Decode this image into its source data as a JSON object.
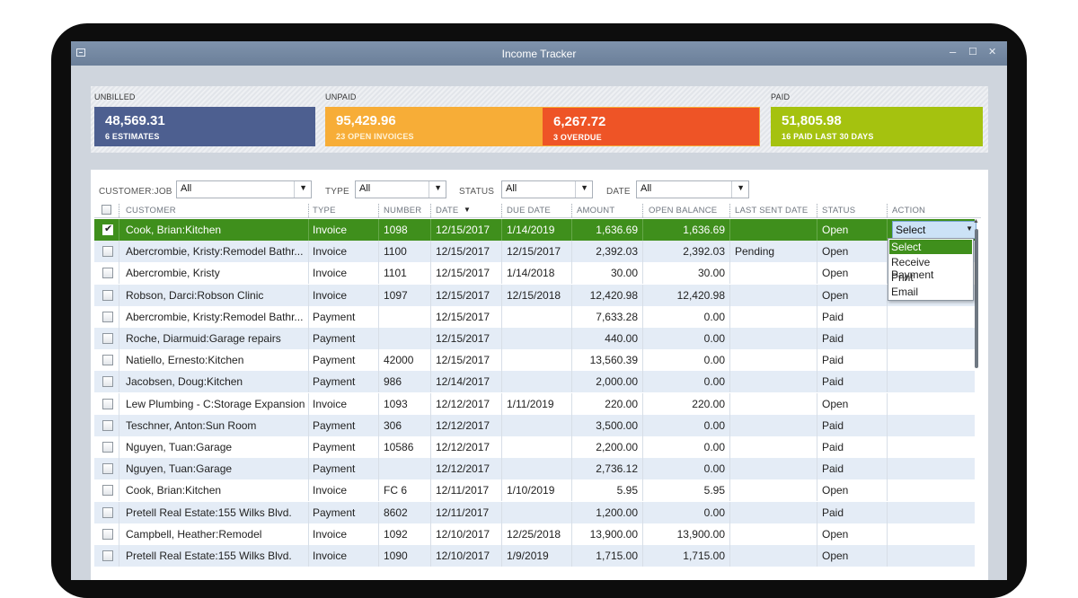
{
  "window": {
    "title": "Income Tracker",
    "min_glyph": "–",
    "max_glyph": "☐",
    "close_glyph": "✕"
  },
  "summary": {
    "unbilled": {
      "label": "UNBILLED",
      "amount": "48,569.31",
      "sub": "6 ESTIMATES",
      "color": "#4d5f90"
    },
    "unpaid": {
      "label": "UNPAID",
      "open": {
        "amount": "95,429.96",
        "sub": "23 OPEN INVOICES",
        "color": "#f7ad37"
      },
      "overdue": {
        "amount": "6,267.72",
        "sub": "3 OVERDUE",
        "color": "#ee5426"
      }
    },
    "paid": {
      "label": "PAID",
      "amount": "51,805.98",
      "sub": "16 PAID LAST 30 DAYS",
      "color": "#a5c20f"
    }
  },
  "filters": {
    "customer_job": {
      "label": "CUSTOMER:JOB",
      "value": "All"
    },
    "type": {
      "label": "TYPE",
      "value": "All"
    },
    "status": {
      "label": "STATUS",
      "value": "All"
    },
    "date": {
      "label": "DATE",
      "value": "All"
    }
  },
  "table": {
    "columns": [
      "CUSTOMER",
      "TYPE",
      "NUMBER",
      "DATE",
      "DUE DATE",
      "AMOUNT",
      "OPEN BALANCE",
      "LAST SENT DATE",
      "STATUS",
      "ACTION"
    ],
    "sort_indicator": "▼",
    "rows": [
      {
        "checked": true,
        "customer": "Cook, Brian:Kitchen",
        "type": "Invoice",
        "number": "1098",
        "date": "12/15/2017",
        "due_date": "1/14/2019",
        "amount": "1,636.69",
        "open_balance": "1,636.69",
        "last_sent": "",
        "status": "Open",
        "action": "Select"
      },
      {
        "checked": false,
        "customer": "Abercrombie, Kristy:Remodel Bathr...",
        "type": "Invoice",
        "number": "1100",
        "date": "12/15/2017",
        "due_date": "12/15/2017",
        "amount": "2,392.03",
        "open_balance": "2,392.03",
        "last_sent": "Pending",
        "status": "Open",
        "action": ""
      },
      {
        "checked": false,
        "customer": "Abercrombie, Kristy",
        "type": "Invoice",
        "number": "1101",
        "date": "12/15/2017",
        "due_date": "1/14/2018",
        "amount": "30.00",
        "open_balance": "30.00",
        "last_sent": "",
        "status": "Open",
        "action": ""
      },
      {
        "checked": false,
        "customer": "Robson, Darci:Robson Clinic",
        "type": "Invoice",
        "number": "1097",
        "date": "12/15/2017",
        "due_date": "12/15/2018",
        "amount": "12,420.98",
        "open_balance": "12,420.98",
        "last_sent": "",
        "status": "Open",
        "action": ""
      },
      {
        "checked": false,
        "customer": "Abercrombie, Kristy:Remodel Bathr...",
        "type": "Payment",
        "number": "",
        "date": "12/15/2017",
        "due_date": "",
        "amount": "7,633.28",
        "open_balance": "0.00",
        "last_sent": "",
        "status": "Paid",
        "action": ""
      },
      {
        "checked": false,
        "customer": "Roche, Diarmuid:Garage repairs",
        "type": "Payment",
        "number": "",
        "date": "12/15/2017",
        "due_date": "",
        "amount": "440.00",
        "open_balance": "0.00",
        "last_sent": "",
        "status": "Paid",
        "action": ""
      },
      {
        "checked": false,
        "customer": "Natiello, Ernesto:Kitchen",
        "type": "Payment",
        "number": "42000",
        "date": "12/15/2017",
        "due_date": "",
        "amount": "13,560.39",
        "open_balance": "0.00",
        "last_sent": "",
        "status": "Paid",
        "action": ""
      },
      {
        "checked": false,
        "customer": "Jacobsen, Doug:Kitchen",
        "type": "Payment",
        "number": "986",
        "date": "12/14/2017",
        "due_date": "",
        "amount": "2,000.00",
        "open_balance": "0.00",
        "last_sent": "",
        "status": "Paid",
        "action": ""
      },
      {
        "checked": false,
        "customer": "Lew Plumbing - C:Storage Expansion",
        "type": "Invoice",
        "number": "1093",
        "date": "12/12/2017",
        "due_date": "1/11/2019",
        "amount": "220.00",
        "open_balance": "220.00",
        "last_sent": "",
        "status": "Open",
        "action": ""
      },
      {
        "checked": false,
        "customer": "Teschner, Anton:Sun Room",
        "type": "Payment",
        "number": "306",
        "date": "12/12/2017",
        "due_date": "",
        "amount": "3,500.00",
        "open_balance": "0.00",
        "last_sent": "",
        "status": "Paid",
        "action": ""
      },
      {
        "checked": false,
        "customer": "Nguyen, Tuan:Garage",
        "type": "Payment",
        "number": "10586",
        "date": "12/12/2017",
        "due_date": "",
        "amount": "2,200.00",
        "open_balance": "0.00",
        "last_sent": "",
        "status": "Paid",
        "action": ""
      },
      {
        "checked": false,
        "customer": "Nguyen, Tuan:Garage",
        "type": "Payment",
        "number": "",
        "date": "12/12/2017",
        "due_date": "",
        "amount": "2,736.12",
        "open_balance": "0.00",
        "last_sent": "",
        "status": "Paid",
        "action": ""
      },
      {
        "checked": false,
        "customer": "Cook, Brian:Kitchen",
        "type": "Invoice",
        "number": "FC 6",
        "date": "12/11/2017",
        "due_date": "1/10/2019",
        "amount": "5.95",
        "open_balance": "5.95",
        "last_sent": "",
        "status": "Open",
        "action": ""
      },
      {
        "checked": false,
        "customer": "Pretell Real Estate:155 Wilks Blvd.",
        "type": "Payment",
        "number": "8602",
        "date": "12/11/2017",
        "due_date": "",
        "amount": "1,200.00",
        "open_balance": "0.00",
        "last_sent": "",
        "status": "Paid",
        "action": ""
      },
      {
        "checked": false,
        "customer": "Campbell, Heather:Remodel",
        "type": "Invoice",
        "number": "1092",
        "date": "12/10/2017",
        "due_date": "12/25/2018",
        "amount": "13,900.00",
        "open_balance": "13,900.00",
        "last_sent": "",
        "status": "Open",
        "action": ""
      },
      {
        "checked": false,
        "customer": "Pretell Real Estate:155 Wilks Blvd.",
        "type": "Invoice",
        "number": "1090",
        "date": "12/10/2017",
        "due_date": "1/9/2019",
        "amount": "1,715.00",
        "open_balance": "1,715.00",
        "last_sent": "",
        "status": "Open",
        "action": ""
      }
    ]
  },
  "action_menu": {
    "options": [
      "Select",
      "Receive Payment",
      "Print",
      "Email"
    ],
    "highlighted": "Select"
  },
  "colors": {
    "selected_row": "#3f8f1c",
    "alt_row": "#e4ecf6",
    "titlebar": "#7489a3"
  }
}
